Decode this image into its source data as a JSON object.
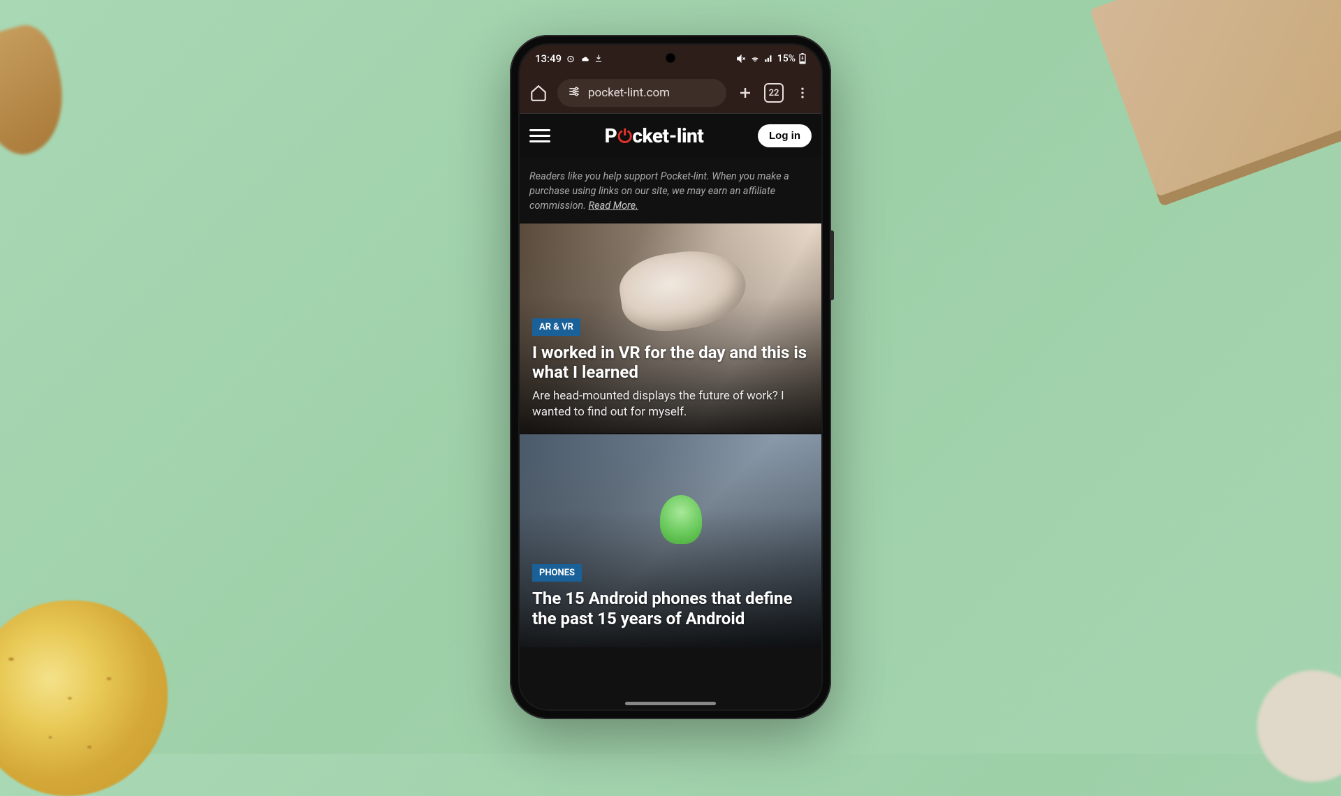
{
  "status": {
    "time": "13:49",
    "battery": "15%"
  },
  "browser": {
    "url": "pocket-lint.com",
    "tab_count": "22"
  },
  "header": {
    "logo_prefix": "P",
    "logo_suffix": "cket-lint",
    "login_label": "Log in"
  },
  "affiliate": {
    "text": "Readers like you help support Pocket-lint. When you make a purchase using links on our site, we may earn an affiliate commission. ",
    "link": "Read More."
  },
  "articles": [
    {
      "category": "AR & VR",
      "title": "I worked in VR for the day and this is what I learned",
      "subtitle": "Are head-mounted displays the future of work? I wanted to find out for myself."
    },
    {
      "category": "PHONES",
      "title": "The 15 Android phones that define the past 15 years of Android",
      "subtitle": ""
    }
  ]
}
